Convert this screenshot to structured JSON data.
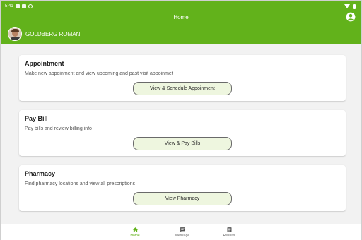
{
  "status_bar": {
    "time": "5:41"
  },
  "header": {
    "title": "Home",
    "user_name": "GOLDBERG ROMAN"
  },
  "cards": [
    {
      "title": "Appointment",
      "description": "Make new appoinment and view upcoming and past visit appoinmet",
      "button_label": "View & Schedule Appoinment"
    },
    {
      "title": "Pay Bill",
      "description": "Pay bills and review billing info",
      "button_label": "View & Pay Bills"
    },
    {
      "title": "Pharmacy",
      "description": "Find pharmacy locations and view all prescriptions",
      "button_label": "View Pharmacy"
    }
  ],
  "bottom_nav": {
    "items": [
      {
        "label": "Home",
        "icon": "home-icon",
        "active": true
      },
      {
        "label": "Message",
        "icon": "message-icon",
        "active": false
      },
      {
        "label": "Results",
        "icon": "results-icon",
        "active": false
      }
    ]
  },
  "colors": {
    "brand_green": "#62b21b",
    "button_fill": "#eef6df",
    "background": "#f2f2f2"
  }
}
